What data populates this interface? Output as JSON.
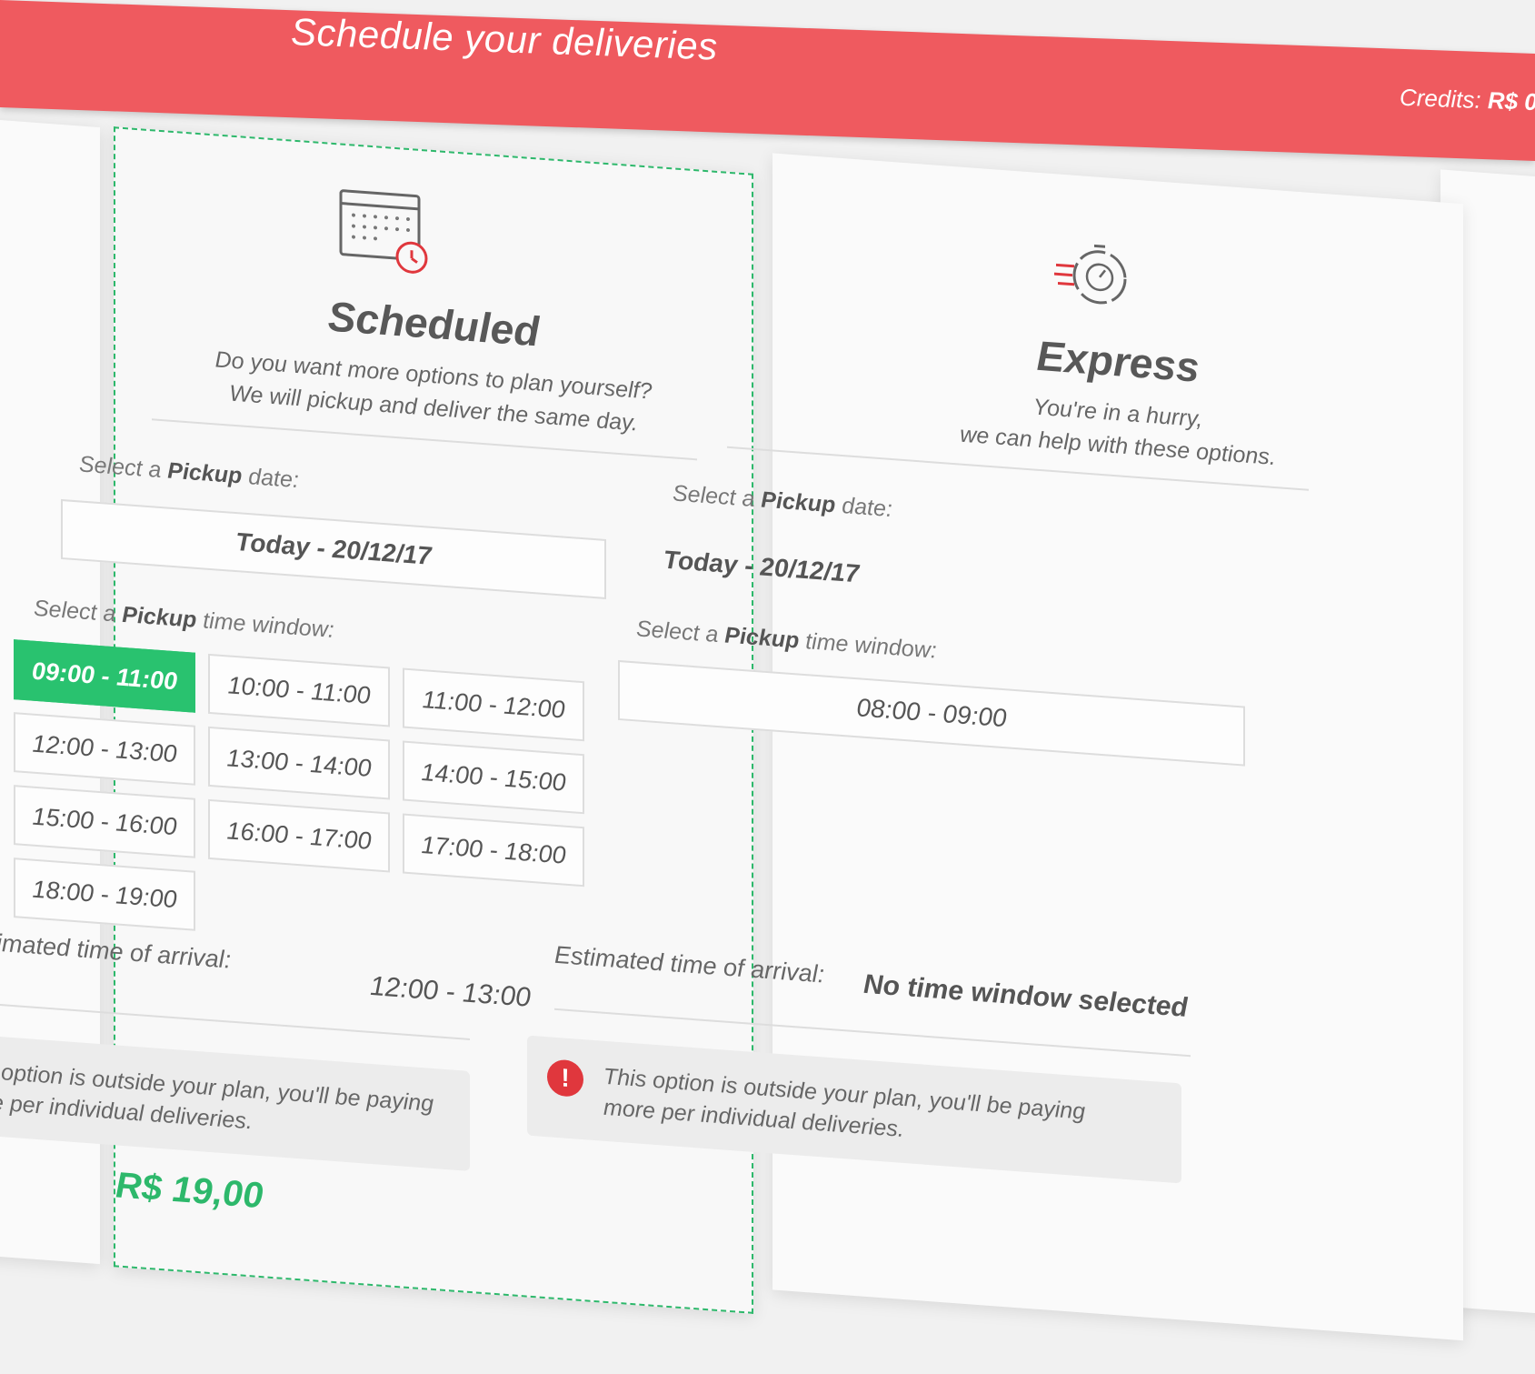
{
  "header": {
    "title": "Schedule your deliveries",
    "credits_label": "Credits:",
    "credits_value": "R$ 0"
  },
  "scheduled": {
    "icon": "calendar-clock-icon",
    "title": "Scheduled",
    "desc_line1": "Do you want more options to plan yourself?",
    "desc_line2": "We will pickup and deliver the same day.",
    "pickup_date_prefix": "Select a ",
    "pickup_date_bold": "Pickup",
    "pickup_date_suffix": " date:",
    "pickup_date_value": "Today - 20/12/17",
    "time_window_prefix": "Select a ",
    "time_window_bold": "Pickup",
    "time_window_suffix": " time window:",
    "slots": [
      "09:00 - 11:00",
      "10:00 - 11:00",
      "11:00 - 12:00",
      "12:00 - 13:00",
      "13:00 - 14:00",
      "14:00 - 15:00",
      "15:00 - 16:00",
      "16:00 - 17:00",
      "17:00 - 18:00",
      "18:00 - 19:00"
    ],
    "selected_slot": "09:00 - 11:00",
    "eta_label": "Estimated time of arrival:",
    "eta_value": "12:00 - 13:00",
    "notice_line1": "This option is outside your plan, you'll be paying",
    "notice_line2": "more per individual deliveries.",
    "price": "R$ 19,00"
  },
  "express": {
    "icon": "stopwatch-speed-icon",
    "title": "Express",
    "desc_line1": "You're in a hurry,",
    "desc_line2": "we can help with these options.",
    "pickup_date_prefix": "Select a ",
    "pickup_date_bold": "Pickup",
    "pickup_date_suffix": " date:",
    "pickup_date_value": "Today - 20/12/17",
    "time_window_prefix": "Select a ",
    "time_window_bold": "Pickup",
    "time_window_suffix": " time window:",
    "time_window_value": "08:00 - 09:00",
    "eta_label": "Estimated time of arrival:",
    "eta_value": "No time window selected",
    "notice_line1": "This option is outside your plan, you'll be paying",
    "notice_line2": "more per individual deliveries.",
    "warn_symbol": "!"
  },
  "colors": {
    "header": "#ef5a5f",
    "accent_green": "#29c26f",
    "warning_red": "#e0373d"
  }
}
